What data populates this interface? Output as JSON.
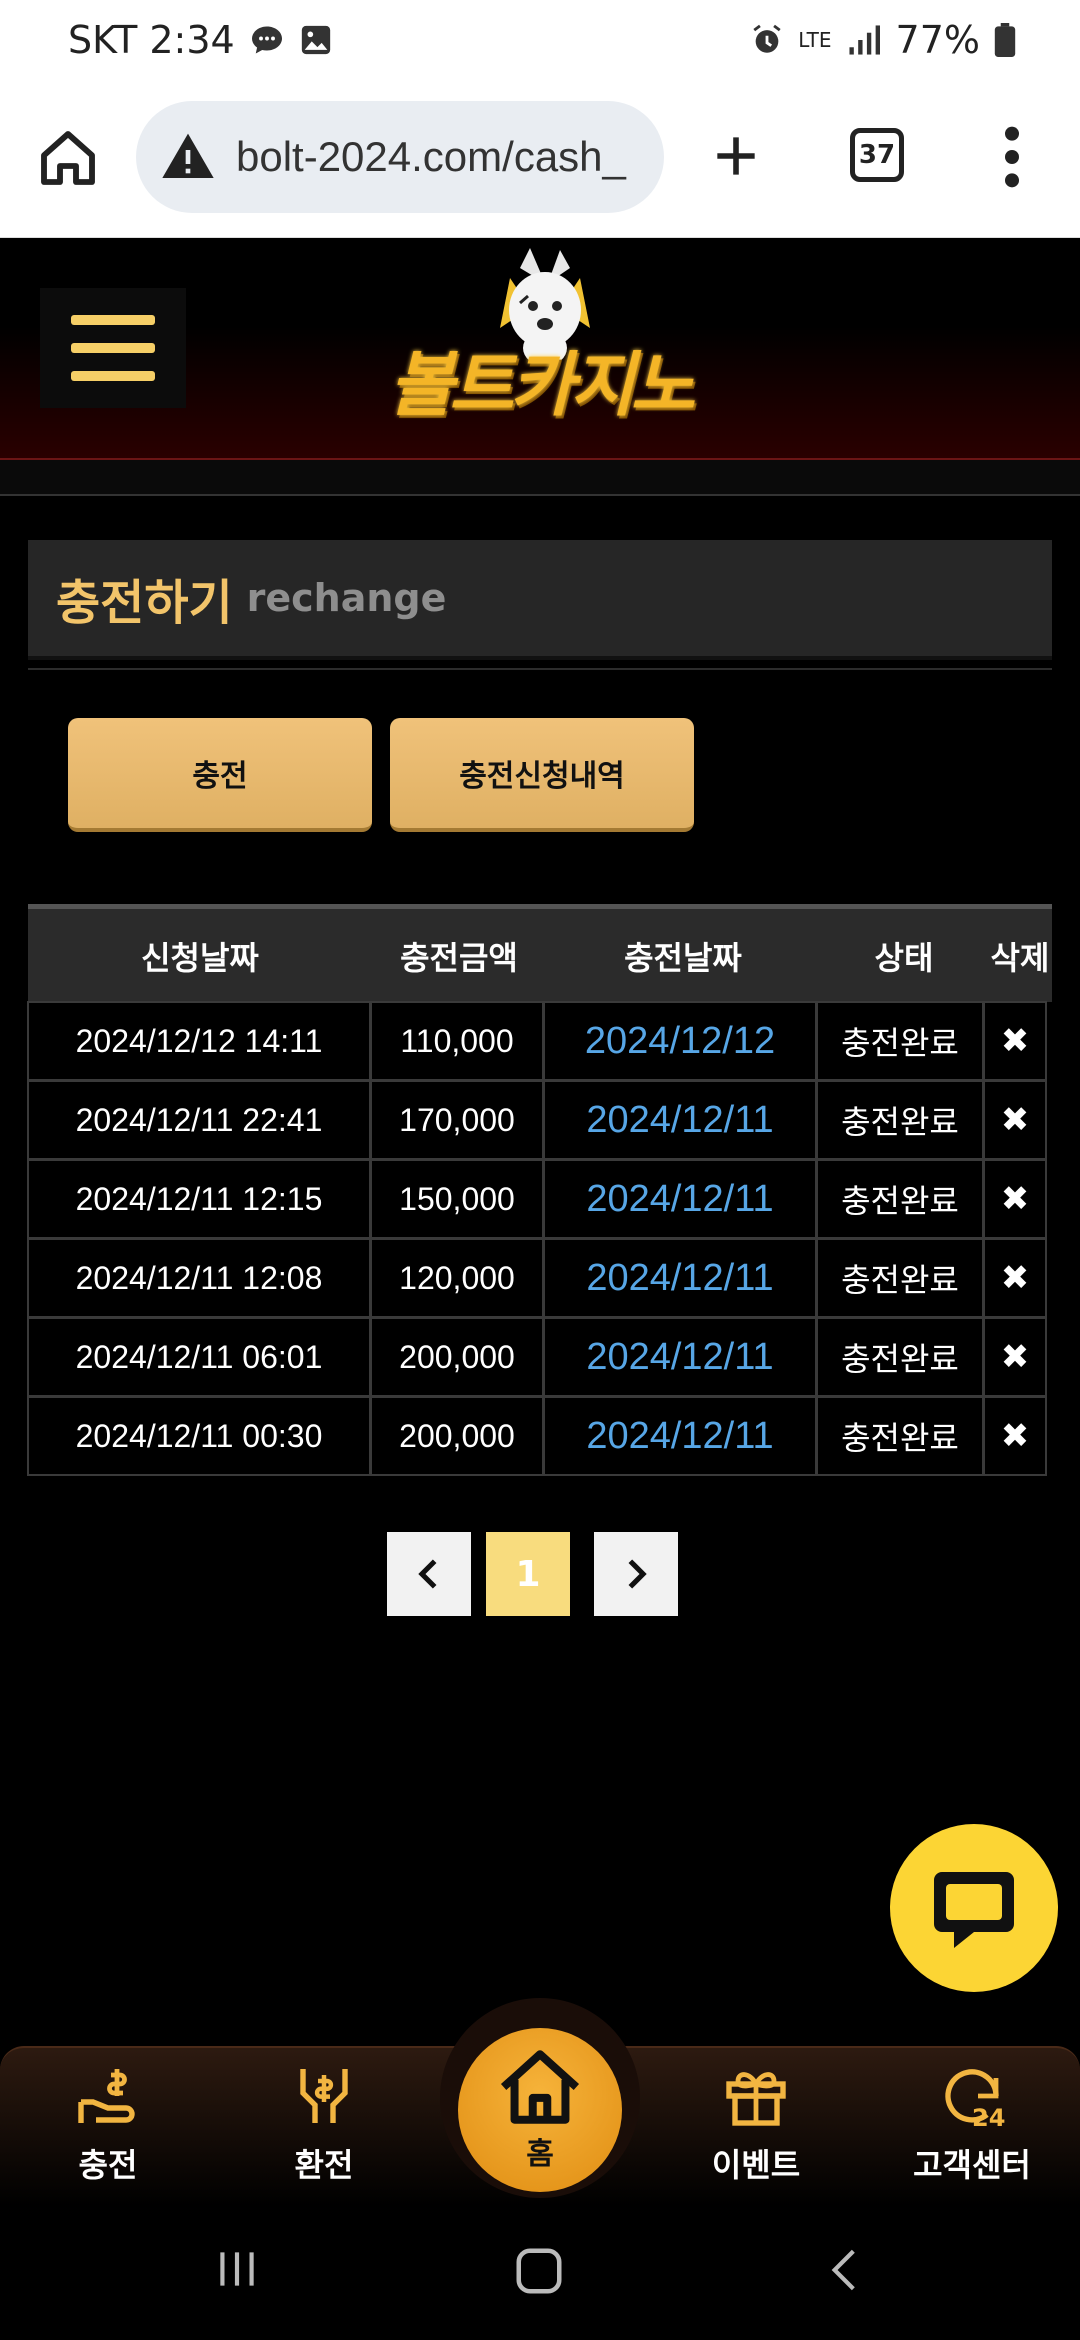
{
  "status_bar": {
    "carrier_time": "SKT 2:34",
    "network": "LTE",
    "battery": "77%"
  },
  "browser": {
    "url": "bolt-2024.com/cash_",
    "tab_count": "37"
  },
  "site": {
    "logo_text": "볼트카지노"
  },
  "panel": {
    "title": "충전하기",
    "subtitle": "rechange"
  },
  "actions": {
    "charge_label": "충전",
    "history_label": "충전신청내역"
  },
  "table": {
    "headers": [
      "신청날짜",
      "충전금액",
      "충전날짜",
      "상태",
      "삭제"
    ],
    "rows": [
      {
        "requested": "2024/12/12 14:11",
        "amount": "110,000",
        "charged": "2024/12/12",
        "status": "충전완료",
        "delete": "✖"
      },
      {
        "requested": "2024/12/11 22:41",
        "amount": "170,000",
        "charged": "2024/12/11",
        "status": "충전완료",
        "delete": "✖"
      },
      {
        "requested": "2024/12/11 12:15",
        "amount": "150,000",
        "charged": "2024/12/11",
        "status": "충전완료",
        "delete": "✖"
      },
      {
        "requested": "2024/12/11 12:08",
        "amount": "120,000",
        "charged": "2024/12/11",
        "status": "충전완료",
        "delete": "✖"
      },
      {
        "requested": "2024/12/11 06:01",
        "amount": "200,000",
        "charged": "2024/12/11",
        "status": "충전완료",
        "delete": "✖"
      },
      {
        "requested": "2024/12/11 00:30",
        "amount": "200,000",
        "charged": "2024/12/11",
        "status": "충전완료",
        "delete": "✖"
      }
    ]
  },
  "pagination": {
    "current_page": "1"
  },
  "bottom_nav": {
    "charge": "충전",
    "exchange": "환전",
    "home": "홈",
    "event": "이벤트",
    "support": "고객센터"
  },
  "colors": {
    "accent_gold": "#f2c46a",
    "link_blue": "#57a6e6",
    "chat_yellow": "#fcd534",
    "home_orange": "#f0a020"
  }
}
